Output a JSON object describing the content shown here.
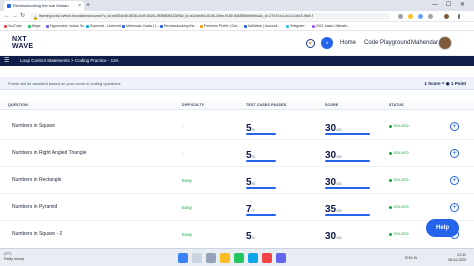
{
  "browser": {
    "tab_title": "Revisionlooking the sub Mohan",
    "new_tab": "+",
    "url": "learning.ccbp.in/tech-foundations/course?c_id=e6454e48-8038-4d49-8026-2f59880522269&t_id=a42db4b0-81d5-40be-9189-5c8385bb5e56c&s_id=27b37a1c-b1c4-4b15-9fa9-f",
    "back": "←",
    "forward": "→",
    "reload": "↻",
    "lock": "🔒",
    "window_min": "—",
    "window_max": "☐",
    "window_close": "✕"
  },
  "bookmarks": [
    {
      "label": "YouTube",
      "color": "#ef4444"
    },
    {
      "label": "Maps",
      "color": "#22c55e"
    },
    {
      "label": "Hypercubic: Indian Sc...",
      "color": "#6366f1"
    },
    {
      "label": "Superset - Universit...",
      "color": "#0ea5e9"
    },
    {
      "label": "Mahendar Yadav | L...",
      "color": "#2563eb"
    },
    {
      "label": "Revisionlooking the...",
      "color": "#2563eb"
    },
    {
      "label": "Freshers Profile | Del...",
      "color": "#f59e0b"
    },
    {
      "label": "NxtWave | Account...",
      "color": "#2563eb"
    },
    {
      "label": "Telegram",
      "color": "#38bdf8"
    },
    {
      "label": "2021 batch Ultimate...",
      "color": "#a855f7"
    }
  ],
  "app": {
    "logo_line1": "NXT",
    "logo_line2": "WAVE",
    "notifications": "4",
    "home_label": "Home",
    "playground_label": "Code Playground",
    "user_name": "Mahendar",
    "menu_icon": "☰",
    "breadcrumb": "Loop Control Statements > Coding Practice - 13A"
  },
  "score_banner": {
    "message": "Points will be awarded based on your score in coding questions",
    "points": "1 Score = ◉ 1 Point"
  },
  "table": {
    "columns": [
      "QUESTION",
      "DIFFICULTY",
      "TEST CASES PASSED",
      "SCORE",
      "STATUS"
    ],
    "rows": [
      {
        "question": "Numbers in Square",
        "difficulty": "-",
        "passed": "5",
        "total": "/5",
        "score": "30",
        "score_total": "/30",
        "progress": 1.0,
        "status": "SOLVED"
      },
      {
        "question": "Numbers in Right Angled Triangle",
        "difficulty": "-",
        "passed": "5",
        "total": "/5",
        "score": "30",
        "score_total": "/30",
        "progress": 1.0,
        "status": "SOLVED"
      },
      {
        "question": "Numbers in Rectangle",
        "difficulty": "Easy",
        "passed": "5",
        "total": "/5",
        "score": "30",
        "score_total": "/30",
        "progress": 1.0,
        "status": "SOLVED"
      },
      {
        "question": "Numbers in Pyramid",
        "difficulty": "Easy",
        "passed": "7",
        "total": "/7",
        "score": "35",
        "score_total": "/35",
        "progress": 1.0,
        "status": "SOLVED"
      },
      {
        "question": "Numbers in Square - 2",
        "difficulty": "Easy",
        "passed": "5",
        "total": "/5",
        "score": "30",
        "score_total": "/30",
        "progress": 1.0,
        "status": "SOLVED"
      }
    ],
    "action_icon": "+"
  },
  "help_label": "Help",
  "taskbar": {
    "temperature": "27°C",
    "weather": "Partly cloudy",
    "lang": "ENG",
    "region": "IN",
    "time": "23:32",
    "date": "08-04-2023"
  },
  "colors": {
    "accent": "#2563eb",
    "navy": "#0f1d4a",
    "solved": "#16a34a"
  }
}
